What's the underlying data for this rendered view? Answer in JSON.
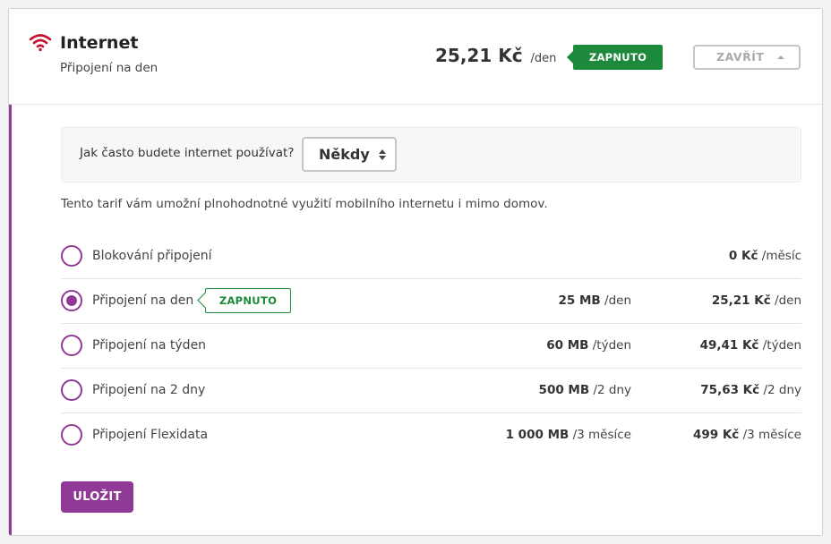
{
  "header": {
    "title": "Internet",
    "subtitle": "Připojení na den",
    "price_value": "25,21 Kč",
    "price_unit": "/den",
    "status_badge": "ZAPNUTO",
    "close_label": "ZAVŘÍT",
    "wifi_icon_color": "#c8102e"
  },
  "usage": {
    "question": "Jak často budete internet používat?",
    "selected": "Někdy"
  },
  "description": "Tento tarif vám umožní plnohodnotné využití mobilního internetu i mimo domov.",
  "options": [
    {
      "label": "Blokování připojení",
      "checked": false,
      "badge": "",
      "data_amount": "",
      "data_unit": "",
      "cost_amount": "0 Kč",
      "cost_unit": "/měsíc"
    },
    {
      "label": "Připojení na den",
      "checked": true,
      "badge": "ZAPNUTO",
      "data_amount": "25 MB",
      "data_unit": "/den",
      "cost_amount": "25,21 Kč",
      "cost_unit": "/den"
    },
    {
      "label": "Připojení na týden",
      "checked": false,
      "badge": "",
      "data_amount": "60 MB",
      "data_unit": "/týden",
      "cost_amount": "49,41 Kč",
      "cost_unit": "/týden"
    },
    {
      "label": "Připojení na 2 dny",
      "checked": false,
      "badge": "",
      "data_amount": "500 MB",
      "data_unit": "/2 dny",
      "cost_amount": "75,63 Kč",
      "cost_unit": "/2 dny"
    },
    {
      "label": "Připojení Flexidata",
      "checked": false,
      "badge": "",
      "data_amount": "1 000 MB",
      "data_unit": "/3 měsíce",
      "cost_amount": "499 Kč",
      "cost_unit": "/3 měsíce"
    }
  ],
  "save_label": "ULOŽIT",
  "colors": {
    "accent": "#8e3a96",
    "success": "#1c8a3a",
    "icon_red": "#c8102e"
  }
}
